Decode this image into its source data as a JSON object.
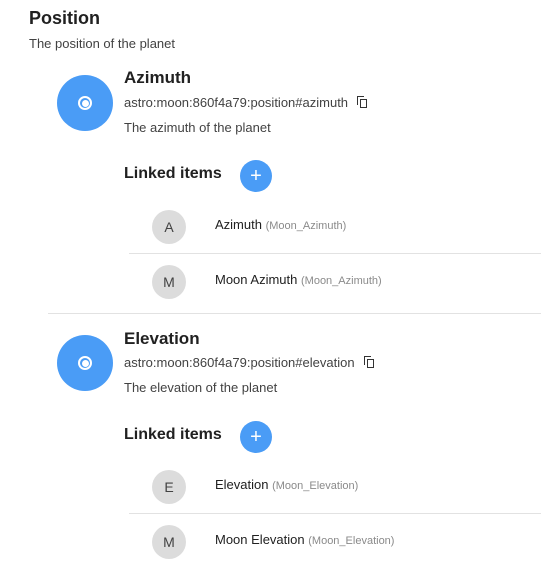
{
  "group": {
    "title": "Position",
    "description": "The position of the planet"
  },
  "channels": [
    {
      "label": "Azimuth",
      "uid": "astro:moon:860f4a79:position#azimuth",
      "description": "The azimuth of the planet",
      "icon": "radio-button-icon",
      "linked_title": "Linked items",
      "add_label": "+",
      "items": [
        {
          "initial": "A",
          "label": "Azimuth",
          "name": "(Moon_Azimuth)"
        },
        {
          "initial": "M",
          "label": "Moon Azimuth",
          "name": "(Moon_Azimuth)"
        }
      ]
    },
    {
      "label": "Elevation",
      "uid": "astro:moon:860f4a79:position#elevation",
      "description": "The elevation of the planet",
      "icon": "radio-button-icon",
      "linked_title": "Linked items",
      "add_label": "+",
      "items": [
        {
          "initial": "E",
          "label": "Elevation",
          "name": "(Moon_Elevation)"
        },
        {
          "initial": "M",
          "label": "Moon Elevation",
          "name": "(Moon_Elevation)"
        }
      ]
    }
  ],
  "colors": {
    "accent": "#4a9cf6",
    "avatar_bg": "#dcdcdc",
    "divider": "#e2e2e2",
    "muted_text": "#8a8a8a"
  }
}
